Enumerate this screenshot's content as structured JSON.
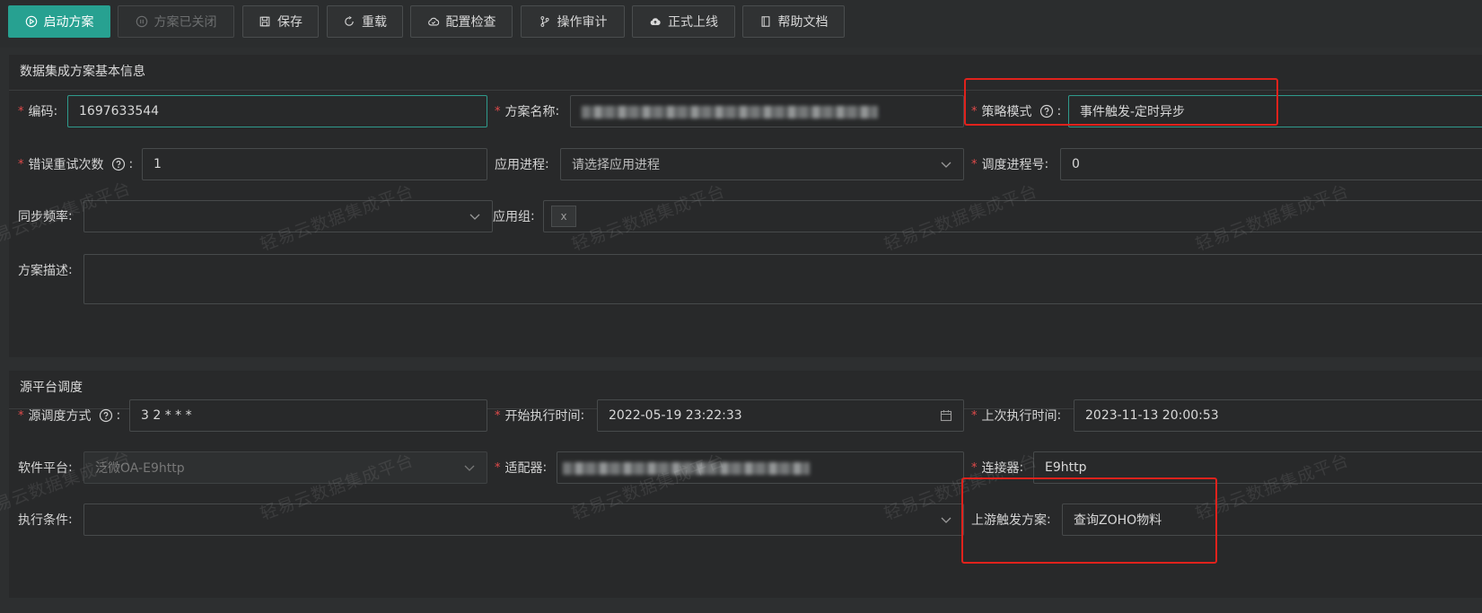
{
  "toolbar": {
    "buttons": [
      {
        "label": "启动方案",
        "icon": "play-circle-icon"
      },
      {
        "label": "方案已关闭",
        "icon": "pause-circle-icon"
      },
      {
        "label": "保存",
        "icon": "save-icon"
      },
      {
        "label": "重载",
        "icon": "reload-icon"
      },
      {
        "label": "配置检查",
        "icon": "cloud-check-icon"
      },
      {
        "label": "操作审计",
        "icon": "branch-icon"
      },
      {
        "label": "正式上线",
        "icon": "cloud-upload-icon"
      },
      {
        "label": "帮助文档",
        "icon": "book-icon"
      }
    ]
  },
  "basic": {
    "title": "数据集成方案基本信息",
    "code": {
      "label": "编码",
      "value": "1697633544"
    },
    "name": {
      "label": "方案名称"
    },
    "strategy": {
      "label": "策略模式",
      "value": "事件触发-定时异步"
    },
    "retry": {
      "label": "错误重试次数",
      "value": "1"
    },
    "app_process": {
      "label": "应用进程",
      "placeholder": "请选择应用进程"
    },
    "dispatch_no": {
      "label": "调度进程号",
      "value": "0"
    },
    "sync_freq": {
      "label": "同步频率",
      "value": ""
    },
    "app_group": {
      "label": "应用组",
      "tag_close": "x"
    },
    "desc": {
      "label": "方案描述",
      "value": ""
    }
  },
  "source": {
    "title": "源平台调度",
    "dispatch_mode": {
      "label": "源调度方式",
      "value": "3 2 * * *"
    },
    "start_time": {
      "label": "开始执行时间",
      "value": "2022-05-19 23:22:33"
    },
    "last_time": {
      "label": "上次执行时间",
      "value": "2023-11-13 20:00:53"
    },
    "platform": {
      "label": "软件平台",
      "value": "泛微OA-E9http"
    },
    "adapter": {
      "label": "适配器"
    },
    "connector": {
      "label": "连接器",
      "value": "E9http"
    },
    "exec_cond": {
      "label": "执行条件",
      "value": ""
    },
    "upstream": {
      "label": "上游触发方案",
      "value": "查询ZOHO物料"
    }
  },
  "label_suffix": ":",
  "watermark": "轻易云数据集成平台",
  "colors": {
    "primary": "#27a191",
    "required": "#e14a4a",
    "highlight": "#e0221c",
    "background": "#2d2f30"
  }
}
